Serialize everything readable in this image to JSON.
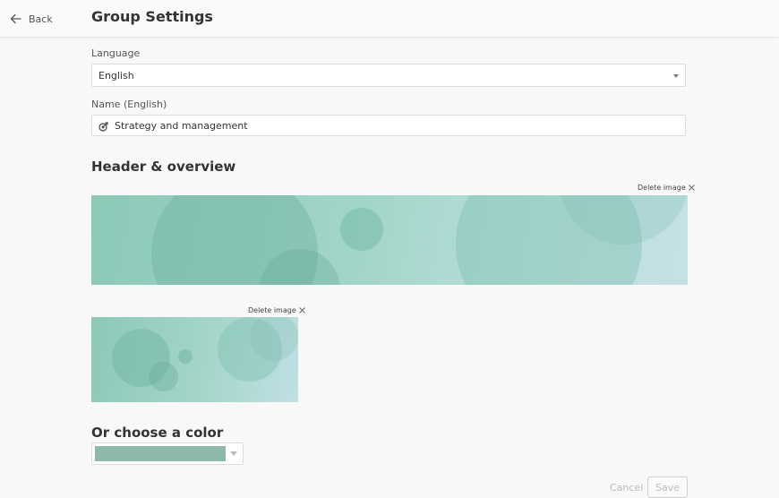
{
  "header": {
    "back_label": "Back",
    "title": "Group Settings"
  },
  "language": {
    "label": "Language",
    "value": "English"
  },
  "name": {
    "label": "Name (English)",
    "value": "Strategy and management",
    "icon": "target-icon"
  },
  "header_overview": {
    "title": "Header & overview",
    "delete_label": "Delete image",
    "thumb_delete_label": "Delete image"
  },
  "color": {
    "title": "Or choose a color",
    "selected": "#8db8ab"
  },
  "actions": {
    "cancel_label": "Cancel",
    "save_label": "Save"
  }
}
